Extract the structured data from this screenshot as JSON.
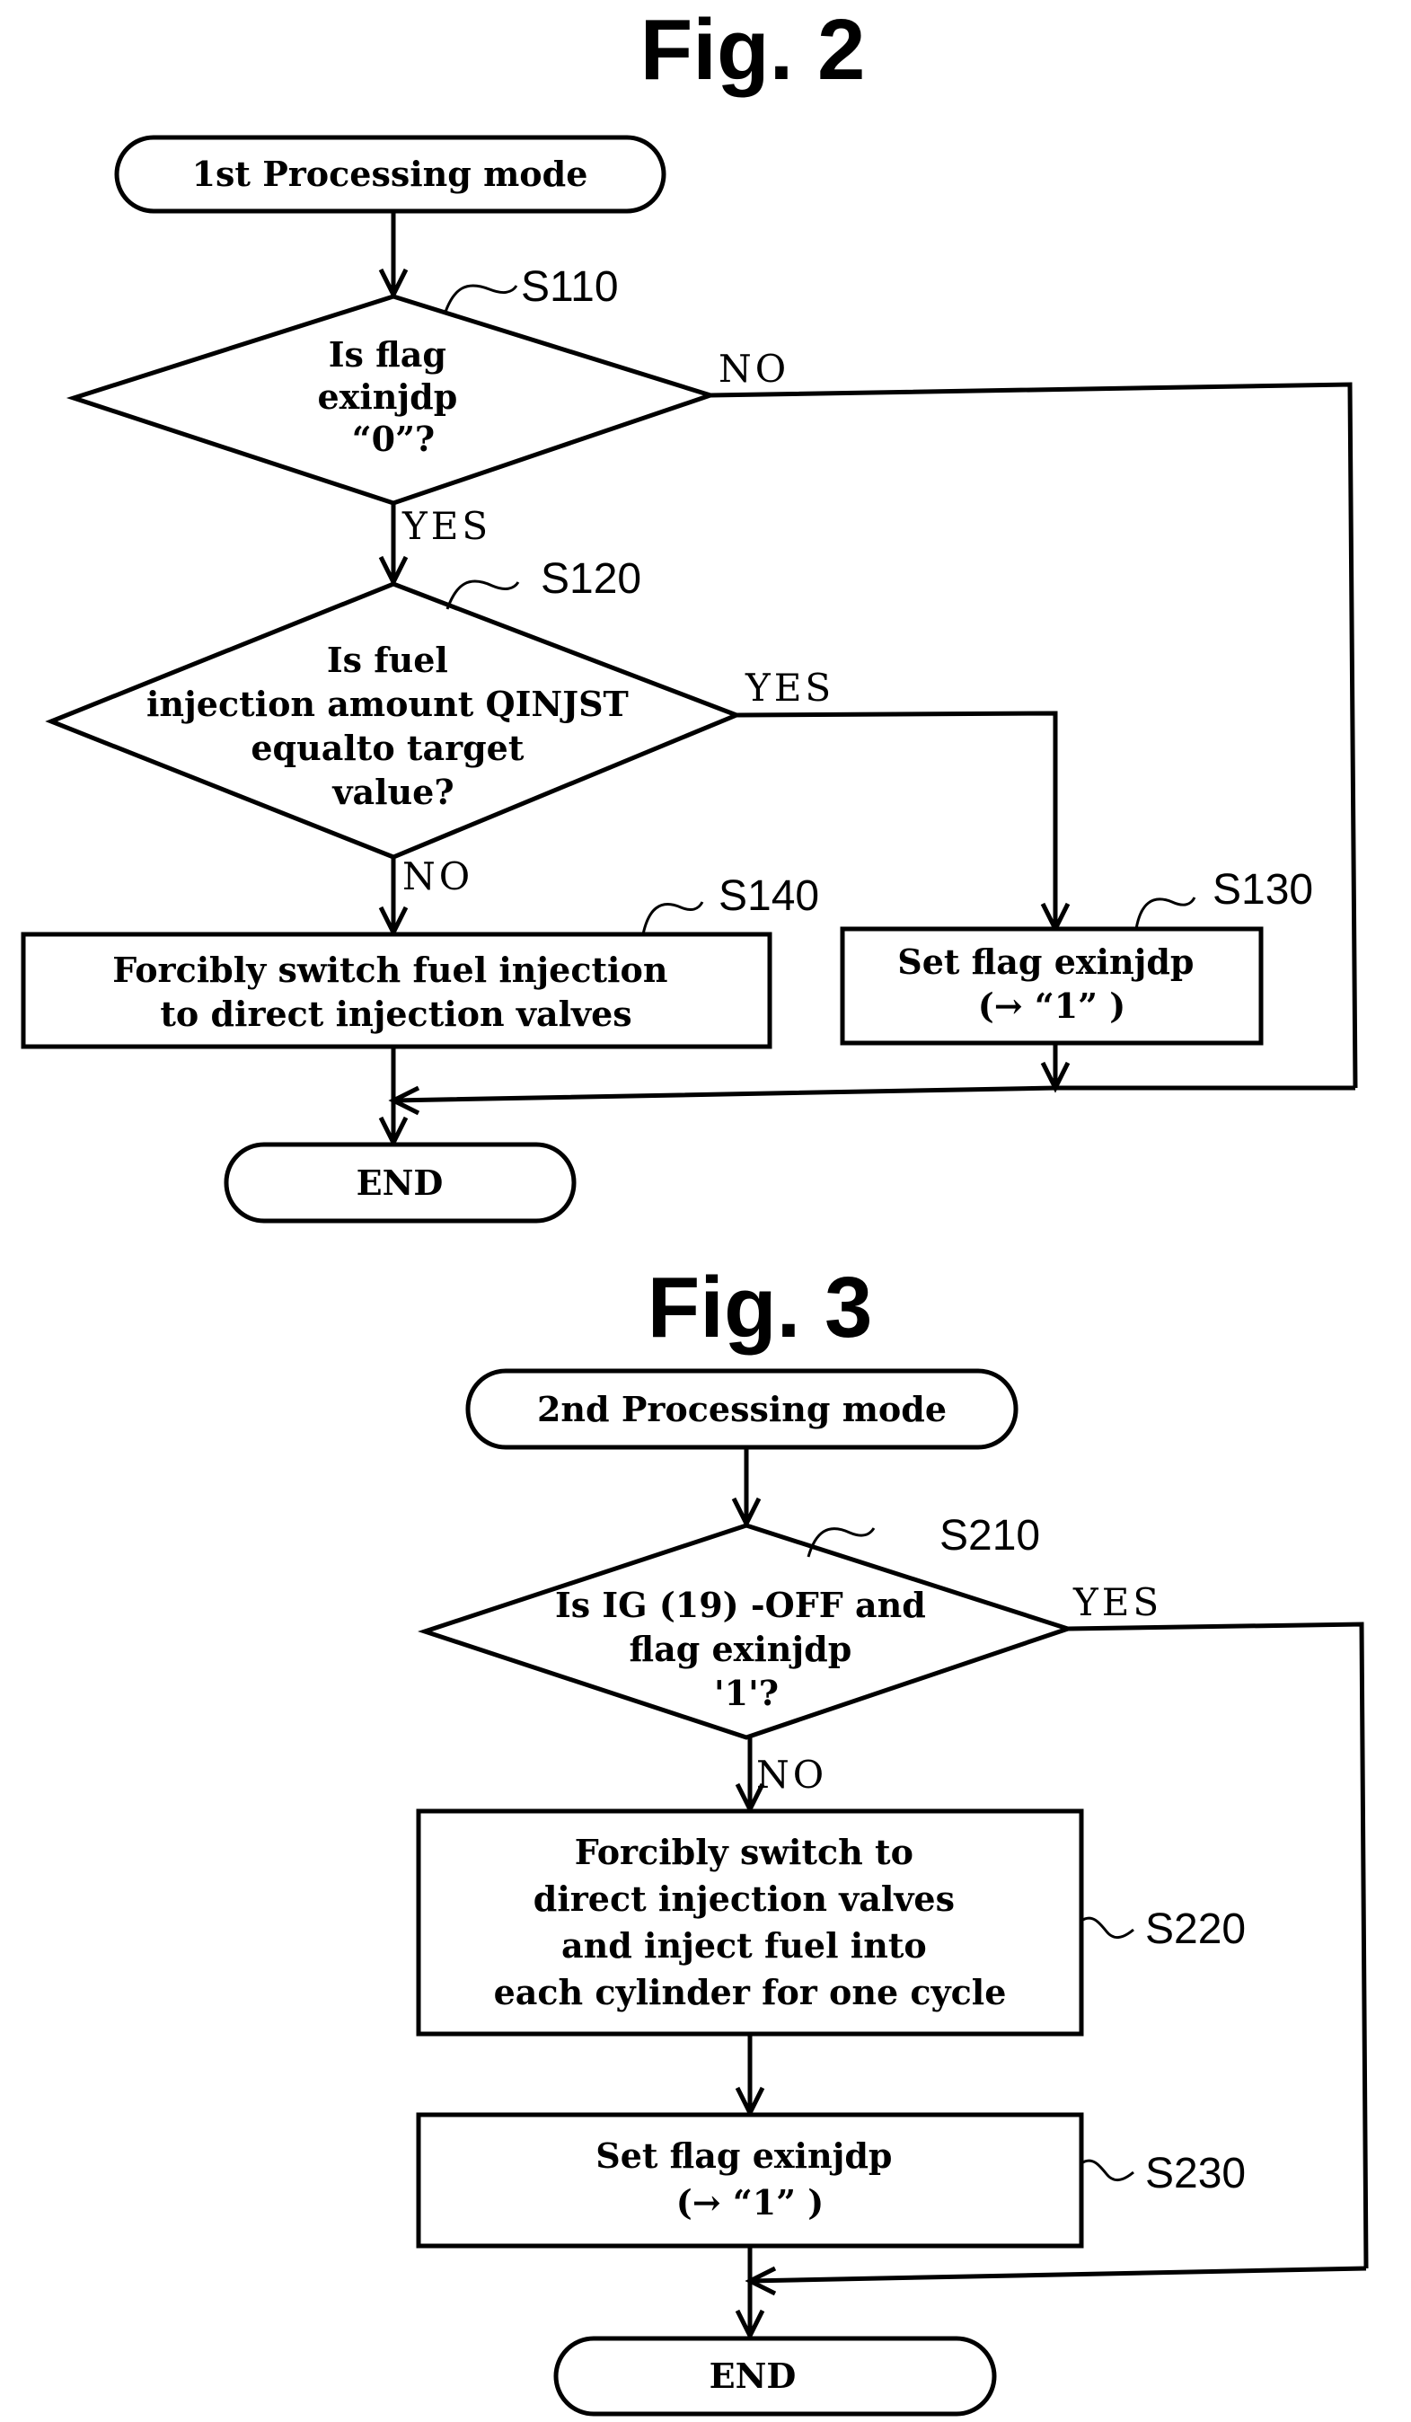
{
  "figures": [
    {
      "title": "Fig. 2",
      "start": "1st Processing mode",
      "decisions": [
        {
          "step": "S110",
          "lines": [
            "Is flag",
            "exinjdp",
            "“0”?"
          ],
          "no": "NO",
          "yes": "YES"
        },
        {
          "step": "S120",
          "lines": [
            "Is fuel",
            "injection amount QINJST",
            "equalto target",
            "value?"
          ],
          "no": "NO",
          "yes": "YES"
        }
      ],
      "processes": [
        {
          "step": "S140",
          "lines": [
            "Forcibly switch fuel injection",
            "to direct injection valves"
          ]
        },
        {
          "step": "S130",
          "lines": [
            "Set flag exinjdp",
            "(→ “1” )"
          ]
        }
      ],
      "end": "END"
    },
    {
      "title": "Fig. 3",
      "start": "2nd Processing mode",
      "decisions": [
        {
          "step": "S210",
          "lines": [
            "Is IG (19) -OFF and",
            "flag exinjdp",
            "'1'?"
          ],
          "no": "NO",
          "yes": "YES"
        }
      ],
      "processes": [
        {
          "step": "S220",
          "lines": [
            "Forcibly switch to",
            "direct injection valves",
            "and inject fuel into",
            "each cylinder for one cycle"
          ]
        },
        {
          "step": "S230",
          "lines": [
            "Set flag exinjdp",
            "(→ “1” )"
          ]
        }
      ],
      "end": "END"
    }
  ]
}
